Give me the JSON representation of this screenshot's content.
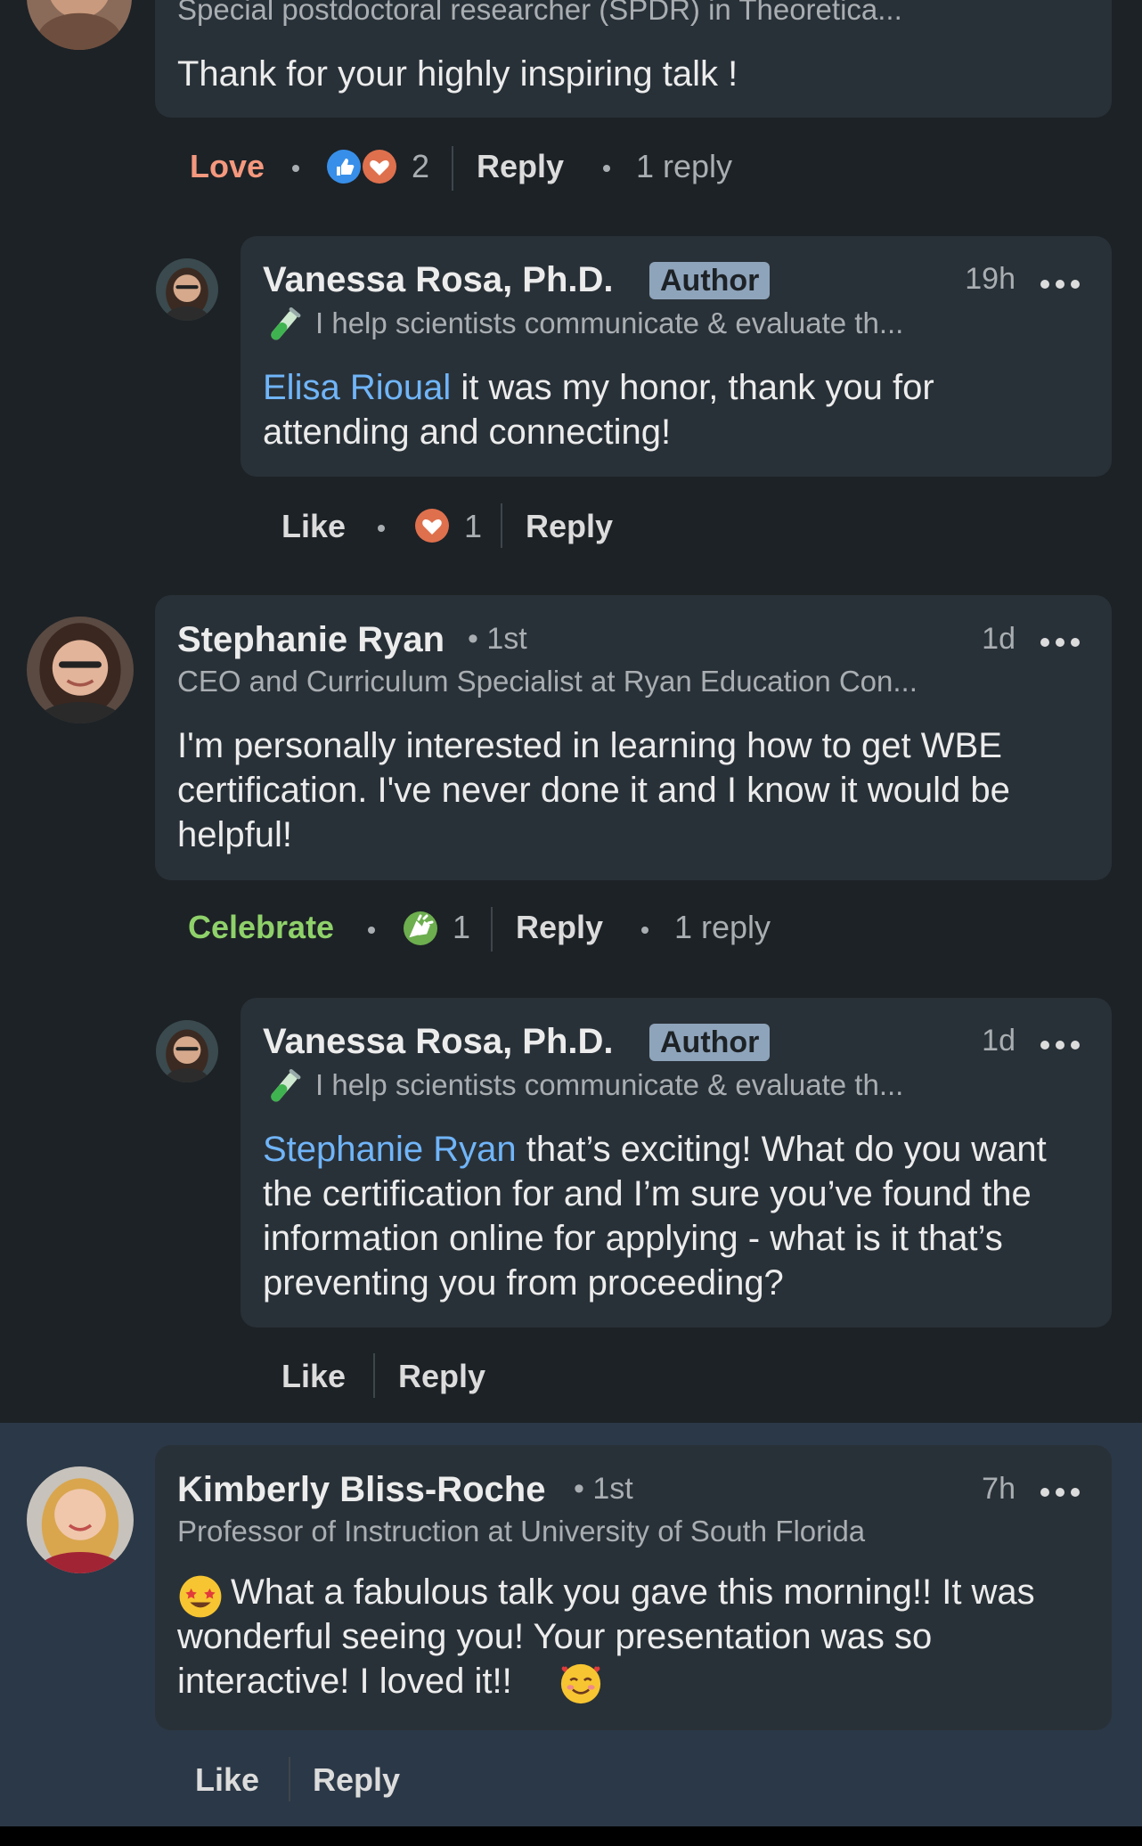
{
  "comments": [
    {
      "headline": "Special postdoctoral researcher (SPDR) in Theoretica...",
      "text": "Thank for your highly inspiring talk !",
      "actions": {
        "reaction_label": "Love",
        "reaction_count": "2",
        "reply_label": "Reply",
        "replies_label": "1 reply"
      }
    },
    {
      "name": "Vanessa Rosa, Ph.D.",
      "badge": "Author",
      "time": "19h",
      "headline": "I help scientists communicate & evaluate th...",
      "mention": "Elisa Rioual",
      "text": " it was my honor, thank you for attending and connecting!",
      "actions": {
        "like_label": "Like",
        "reaction_count": "1",
        "reply_label": "Reply"
      }
    },
    {
      "name": "Stephanie Ryan",
      "degree": "• 1st",
      "time": "1d",
      "headline": "CEO and Curriculum Specialist at Ryan Education Con...",
      "text": "I'm personally interested in learning how to get WBE certification. I've never done it and I know it would be helpful!",
      "actions": {
        "reaction_label": "Celebrate",
        "reaction_count": "1",
        "reply_label": "Reply",
        "replies_label": "1 reply"
      }
    },
    {
      "name": "Vanessa Rosa, Ph.D.",
      "badge": "Author",
      "time": "1d",
      "headline": "I help scientists communicate & evaluate th...",
      "mention": "Stephanie Ryan",
      "text": " that’s exciting! What do you want the certification for and I’m sure you’ve found the information online for applying - what is it that’s preventing you from proceeding?",
      "actions": {
        "like_label": "Like",
        "reply_label": "Reply"
      }
    },
    {
      "name": "Kimberly Bliss-Roche",
      "degree": "• 1st",
      "time": "7h",
      "headline": "Professor of Instruction at University of South Florida",
      "text_main": " What a fabulous talk you gave this morning!! It was wonderful seeing you! Your presentation was so interactive! I loved it!! ",
      "actions": {
        "like_label": "Like",
        "reply_label": "Reply"
      }
    }
  ],
  "colors": {
    "background": "#1d2226",
    "bubble": "#293138",
    "highlight": "#2b3847",
    "love": "#f5987e",
    "celebrate": "#8fd16a",
    "mention": "#70b5f9",
    "author_badge": "#8ea4bb"
  }
}
